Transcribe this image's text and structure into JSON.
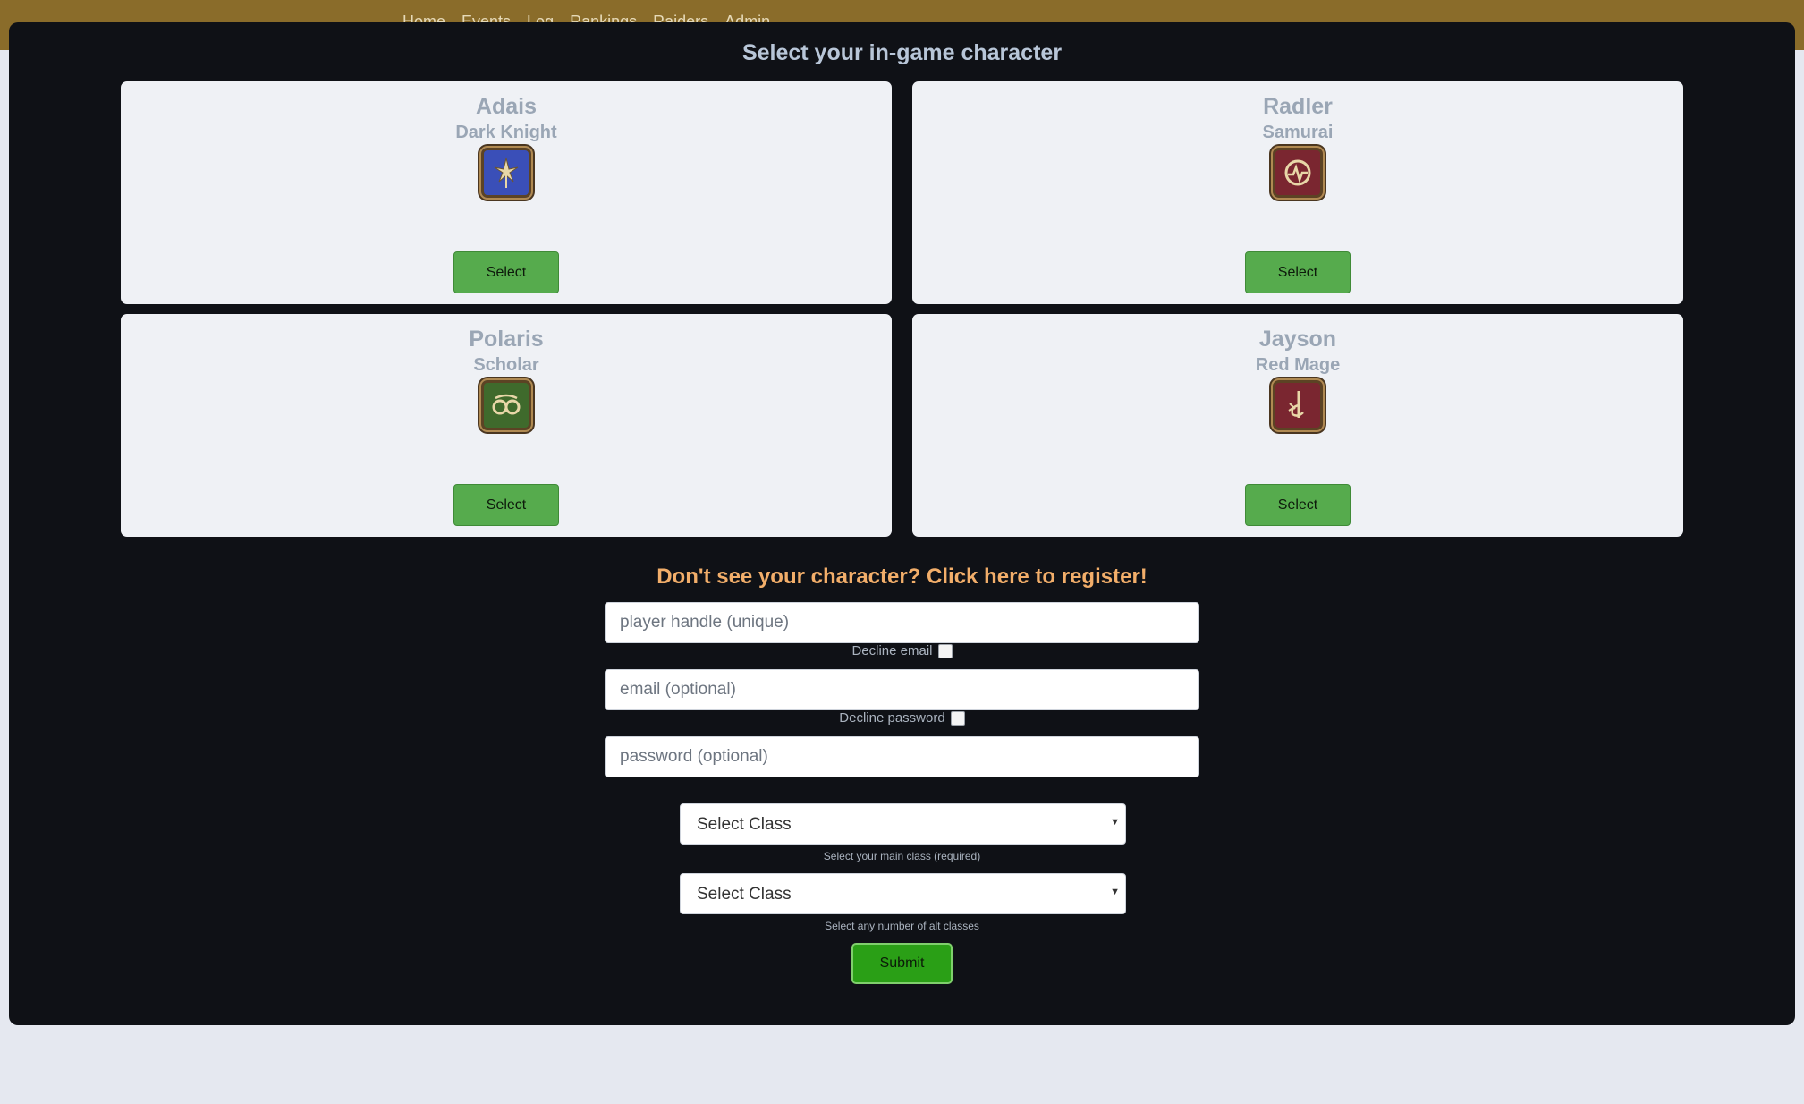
{
  "nav": {
    "items": [
      "Home",
      "Events",
      "Log",
      "Rankings",
      "Raiders",
      "Admin"
    ]
  },
  "modal": {
    "title": "Select your in-game character"
  },
  "characters": [
    {
      "name": "Adais",
      "job": "Dark Knight",
      "icon": "dark-knight-icon",
      "icon_color": "#3a4fb8",
      "select_label": "Select"
    },
    {
      "name": "Radler",
      "job": "Samurai",
      "icon": "samurai-icon",
      "icon_color": "#7a2630",
      "select_label": "Select"
    },
    {
      "name": "Polaris",
      "job": "Scholar",
      "icon": "scholar-icon",
      "icon_color": "#3f6a2c",
      "select_label": "Select"
    },
    {
      "name": "Jayson",
      "job": "Red Mage",
      "icon": "red-mage-icon",
      "icon_color": "#7a2630",
      "select_label": "Select"
    }
  ],
  "register": {
    "title": "Don't see your character? Click here to register!",
    "handle_placeholder": "player handle (unique)",
    "decline_email_label": "Decline email",
    "email_placeholder": "email (optional)",
    "decline_password_label": "Decline password",
    "password_placeholder": "password (optional)",
    "main_class": {
      "value": "Select Class",
      "help": "Select your main class (required)"
    },
    "alt_class": {
      "value": "Select Class",
      "help": "Select any number of alt classes"
    },
    "submit_label": "Submit"
  },
  "colors": {
    "topbar": "#8a6c2a",
    "modal_bg": "#0f1116",
    "card_bg": "#eff1f5",
    "select_button": "#56ab4d",
    "register_title": "#f2ae6a",
    "submit_button": "#2a9f16"
  }
}
